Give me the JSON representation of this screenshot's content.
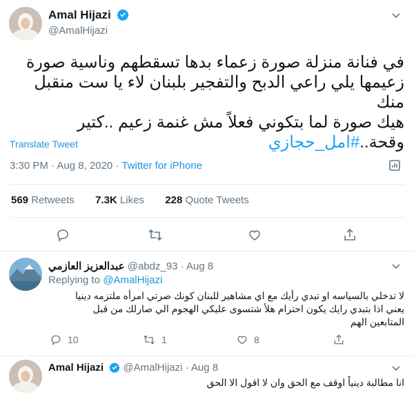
{
  "colors": {
    "accent": "#1da1f2",
    "text": "#14171a",
    "muted": "#657786",
    "divider": "#e6ecf0"
  },
  "tweet": {
    "author_name": "Amal Hijazi",
    "author_handle": "@AmalHijazi",
    "text_lines": [
      "في فنانة منزلة صورة زعماء بدها تسقطهم وناسية صورة",
      "زعيمها يلي راعي الدبح والتفجير  بلبنان لاء يا ست منقبل منك",
      "هيك صورة لما بتكوني فعلاً مش غنمة زعيم ..كتير",
      "وقحة..",
      "#امل_حجازي"
    ],
    "translate_label": "Translate Tweet",
    "timestamp": "3:30 PM · Aug 8, 2020 · ",
    "source": "Twitter for iPhone",
    "stats": {
      "retweets_count": "569",
      "retweets_label": "Retweets",
      "likes_count": "7.3K",
      "likes_label": "Likes",
      "quotes_count": "228",
      "quotes_label": "Quote Tweets"
    },
    "icons": [
      "caret-down-icon",
      "analytics-icon",
      "reply-icon",
      "retweet-icon",
      "like-icon",
      "share-icon"
    ]
  },
  "replies": [
    {
      "author_name": "عبدالعزيز العازمي",
      "author_handle": "@abdz_93",
      "date": "· Aug 8",
      "replying_prefix": "Replying to ",
      "replying_to": "@AmalHijazi",
      "text_lines": [
        "لا تدخلي بالسياسه او تبدي رأيك مع اي  مشاهير للبنان كونك صرتي امرأه ملتزمه دينيا",
        "يعني اذا بتبدي رايك يكون احترام هلأ شتسوى عليكي الهجوم الي صارلك من قبل",
        "المتابعين الهم"
      ],
      "reply_count": "10",
      "retweet_count": "1",
      "like_count": "8"
    },
    {
      "author_name": "Amal Hijazi",
      "author_handle": "@AmalHijazi",
      "date": "· Aug 8",
      "text_lines": [
        "انا مطالبة دينياً اوقف مع الحق وان لا اقول الا الحق"
      ]
    }
  ]
}
